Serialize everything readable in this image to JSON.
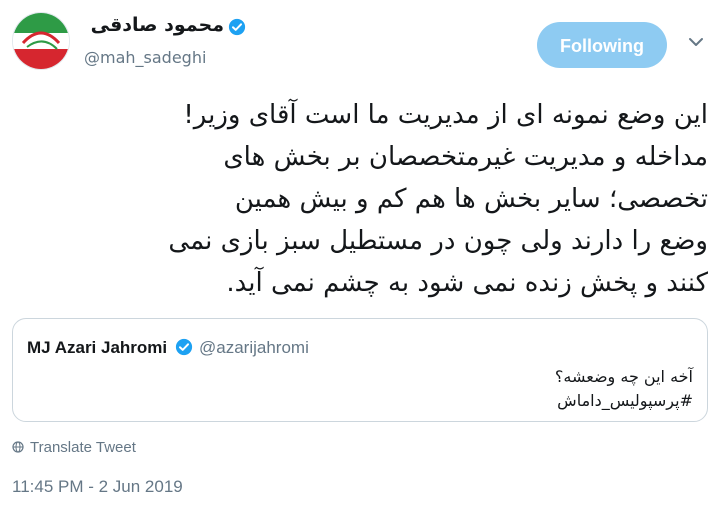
{
  "author": {
    "display_name": "محمود صادقی",
    "handle": "@mah_sadeghi"
  },
  "follow_button": {
    "label": "Following"
  },
  "tweet": {
    "lines": [
      "این وضع نمونه ای از مدیریت ما است آقای وزیر!",
      "مداخله و مدیریت غیرمتخصصان بر بخش های",
      "تخصصی؛ سایر بخش ها هم کم و بیش همین",
      "وضع را دارند ولی چون در مستطیل سبز بازی نمی",
      "کنند و پخش زنده نمی شود به چشم نمی آید."
    ]
  },
  "quoted_tweet": {
    "name": "MJ Azari Jahromi",
    "handle": "@azarijahromi",
    "lines": [
      "آخه این چه وضعشه؟",
      "#پرسپولیس_داماش"
    ]
  },
  "translate_label": "Translate Tweet",
  "timestamp": "11:45 PM - 2 Jun 2019",
  "icons": {
    "verified": "verified-badge-icon",
    "caret": "chevron-down-icon",
    "globe": "globe-icon"
  },
  "colors": {
    "accent": "#1da1f2",
    "follow_bg": "#8ecbf2",
    "muted": "#657786"
  }
}
